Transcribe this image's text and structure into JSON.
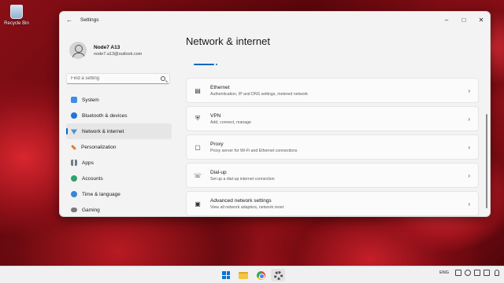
{
  "desktop": {
    "recycle_bin_label": "Recycle Bin"
  },
  "window": {
    "title": "Settings",
    "back_icon": "arrow-left",
    "controls": [
      "minimize",
      "maximize",
      "close"
    ]
  },
  "profile": {
    "name": "Node7 A13",
    "email": "node7.a13@outlook.com"
  },
  "search": {
    "placeholder": "Find a setting",
    "value": ""
  },
  "sidebar": {
    "items": [
      {
        "label": "System",
        "icon": "system-icon",
        "color": "#3b8ee6",
        "active": false
      },
      {
        "label": "Bluetooth & devices",
        "icon": "bluetooth-icon",
        "color": "#1f74d6",
        "active": false
      },
      {
        "label": "Network & internet",
        "icon": "network-icon",
        "color": "#4f8fd6",
        "active": true
      },
      {
        "label": "Personalization",
        "icon": "brush-icon",
        "color": "#e07b3a",
        "active": false
      },
      {
        "label": "Apps",
        "icon": "apps-icon",
        "color": "#6f7b8a",
        "active": false
      },
      {
        "label": "Accounts",
        "icon": "accounts-icon",
        "color": "#2ea36b",
        "active": false
      },
      {
        "label": "Time & language",
        "icon": "globe-clock-icon",
        "color": "#3a87d4",
        "active": false
      },
      {
        "label": "Gaming",
        "icon": "gaming-icon",
        "color": "#7a7a7a",
        "active": false
      }
    ]
  },
  "main": {
    "title": "Network & internet",
    "cards": [
      {
        "title": "Ethernet",
        "subtitle": "Authentication, IP and DNS settings, metered network",
        "icon": "ethernet-icon"
      },
      {
        "title": "VPN",
        "subtitle": "Add, connect, manage",
        "icon": "vpn-shield-icon"
      },
      {
        "title": "Proxy",
        "subtitle": "Proxy server for Wi-Fi and Ethernet connections",
        "icon": "proxy-icon"
      },
      {
        "title": "Dial-up",
        "subtitle": "Set up a dial-up internet connection",
        "icon": "dialup-icon"
      },
      {
        "title": "Advanced network settings",
        "subtitle": "View all network adapters, network reset",
        "icon": "advanced-network-icon"
      }
    ]
  },
  "taskbar": {
    "language": "ENG",
    "accent": "#0a74d6"
  }
}
